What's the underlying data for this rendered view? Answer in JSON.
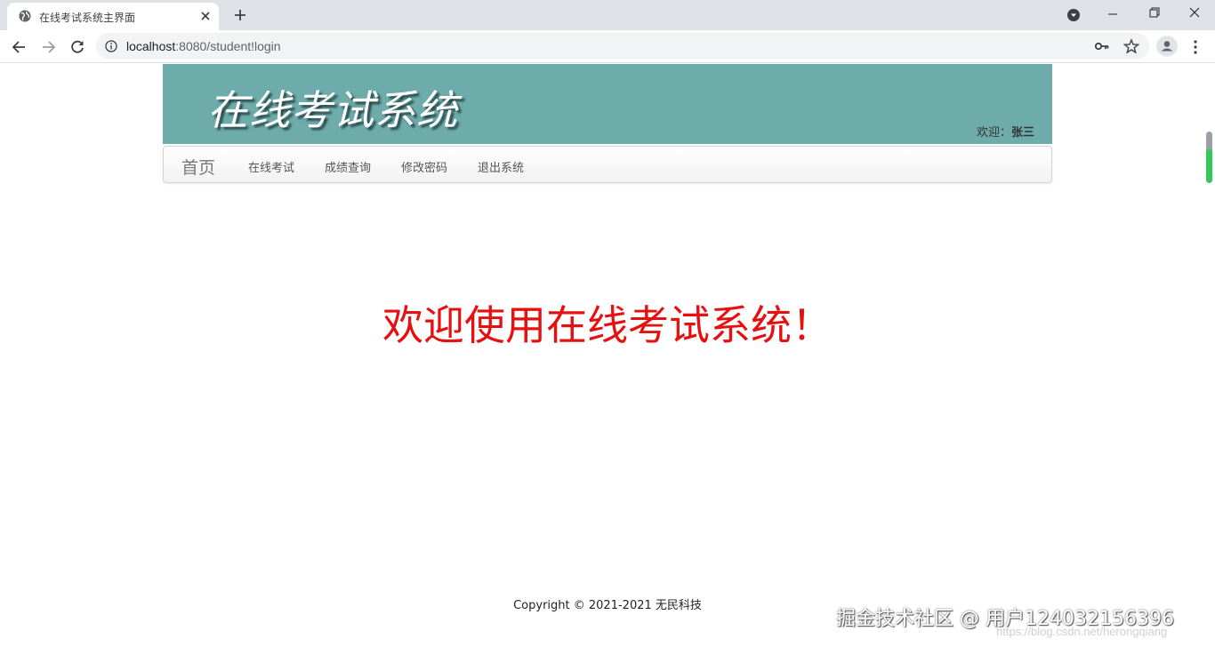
{
  "browser": {
    "tab_title": "在线考试系统主界面",
    "url_host": "localhost",
    "url_path": ":8080/student!login",
    "icons": [
      "globe-icon",
      "close-icon",
      "plus-icon",
      "back-icon",
      "forward-icon",
      "reload-icon",
      "info-icon",
      "key-icon",
      "star-icon",
      "profile-icon",
      "menu-icon"
    ]
  },
  "header": {
    "site_title": "在线考试系统",
    "welcome_label": "欢迎：",
    "username": "张三"
  },
  "nav": {
    "brand": "首页",
    "items": [
      {
        "label": "在线考试"
      },
      {
        "label": "成绩查询"
      },
      {
        "label": "修改密码"
      },
      {
        "label": "退出系统"
      }
    ]
  },
  "main": {
    "hero_text": "欢迎使用在线考试系统！"
  },
  "footer": {
    "copyright": "Copyright © 2021-2021 无民科技"
  },
  "watermark": {
    "text": "掘金技术社区 @ 用户124032156396",
    "url": "https://blog.csdn.net/herongqiang"
  },
  "colors": {
    "header_bg": "#6eabab",
    "hero_text": "#e61010"
  }
}
